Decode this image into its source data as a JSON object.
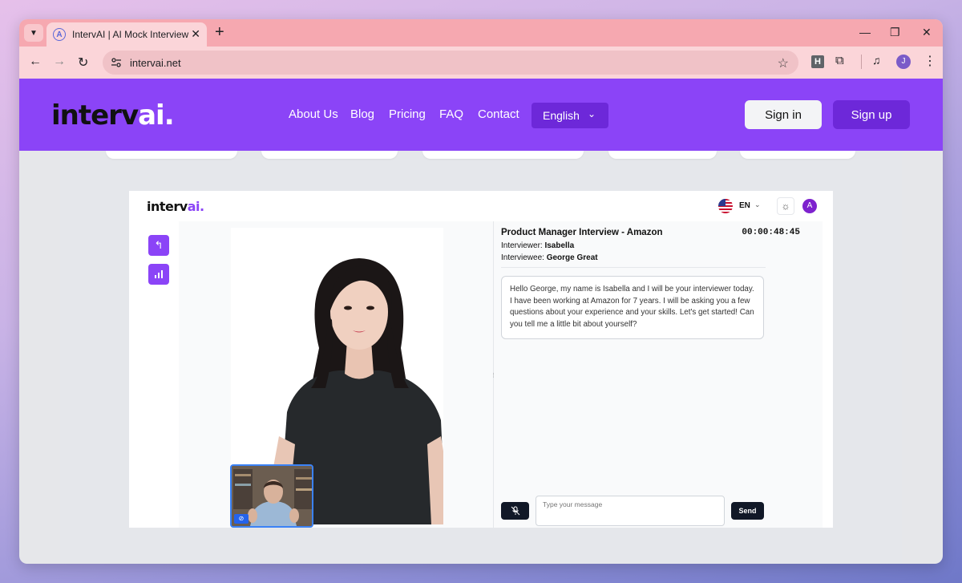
{
  "browser": {
    "tab_title": "IntervAI | AI Mock Interview Platform",
    "tab_favicon_letter": "A",
    "tab_close": "✕",
    "new_tab": "+",
    "window_controls": {
      "minimize": "—",
      "restore": "❐",
      "close": "✕"
    },
    "url": "intervai.net",
    "extension_letter": "H",
    "profile_letter": "J"
  },
  "site": {
    "logo": "intervai.",
    "nav": [
      "About Us",
      "Blog",
      "Pricing",
      "FAQ",
      "Contact"
    ],
    "language": "English",
    "signin": "Sign in",
    "signup": "Sign up"
  },
  "app": {
    "logo": "intervai.",
    "lang_code": "EN",
    "user_initial": "A",
    "interview_title": "Product Manager Interview - Amazon",
    "timer": "00:00:48:45",
    "interviewer_label": "Interviewer:",
    "interviewer_name": "Isabella",
    "interviewee_label": "Interviewee:",
    "interviewee_name": "George Great",
    "message": "Hello George, my name is Isabella and I will be your interviewer today. I have been working at Amazon for 7 years. I will be asking you a few questions about your experience and your skills. Let's get started! Can you tell me a little bit about yourself?",
    "input_placeholder": "Type your message",
    "send_label": "Send"
  },
  "colors": {
    "brand_purple": "#8b44f7",
    "brand_dark_purple": "#6d28d9",
    "tab_strip": "#f6a8b0",
    "toolbar": "#fbd5d9"
  }
}
